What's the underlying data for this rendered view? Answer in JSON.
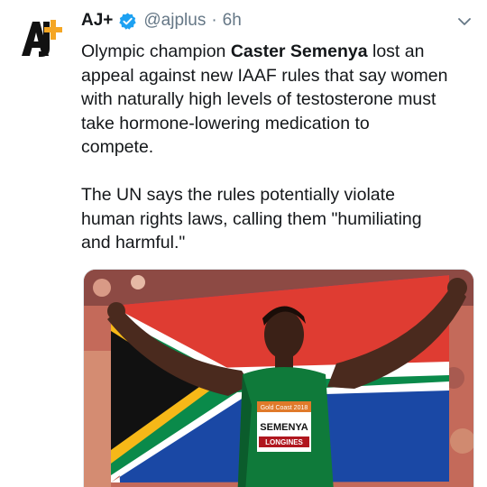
{
  "account": {
    "logo_text": "AJ+",
    "name": "AJ+",
    "handle": "@ajplus",
    "separator": "·",
    "time": "6h"
  },
  "tweet": {
    "line1_pre": "Olympic champion ",
    "line1_bold": "Caster Semenya",
    "line1_post": " lost an",
    "line2": "appeal against new IAAF rules that say women",
    "line3": "with naturally high levels of testosterone must",
    "line4": "take hormone-lowering medication to",
    "line5": "compete.",
    "line6": "The UN says the rules potentially violate",
    "line7": "human rights laws, calling them \"humiliating",
    "line8": "and harmful.\""
  },
  "media": {
    "bib_event": "Gold Coast 2018",
    "bib_name": "SEMENYA",
    "bib_sponsor": "LONGINES"
  },
  "colors": {
    "text": "#14171a",
    "secondary": "#657786",
    "verified": "#1da1f2",
    "logo": "#f5a623"
  }
}
